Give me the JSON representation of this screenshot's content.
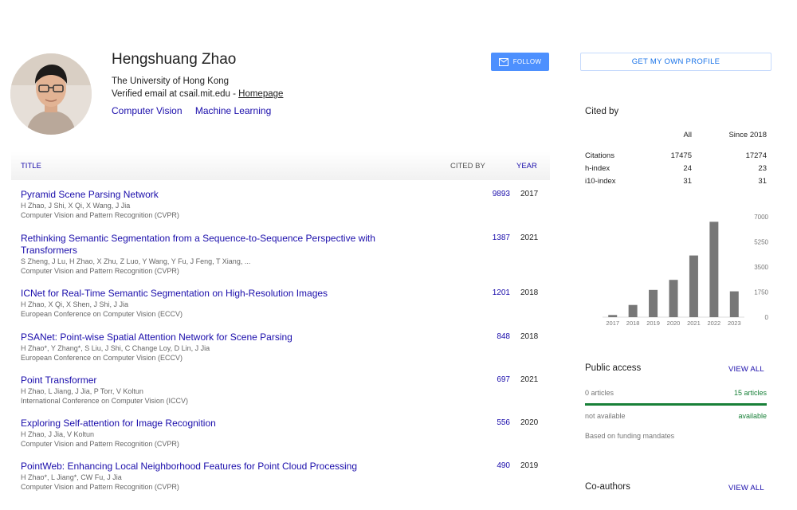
{
  "profile": {
    "name": "Hengshuang Zhao",
    "affiliation": "The University of Hong Kong",
    "email_prefix": "Verified email at csail.mit.edu - ",
    "homepage_label": "Homepage",
    "interests": [
      "Computer Vision",
      "Machine Learning"
    ]
  },
  "buttons": {
    "follow": "FOLLOW",
    "get_profile": "GET MY OWN PROFILE"
  },
  "table": {
    "headers": {
      "title": "TITLE",
      "cited_by": "CITED BY",
      "year": "YEAR"
    },
    "articles": [
      {
        "title": "Pyramid Scene Parsing Network",
        "authors": "H Zhao, J Shi, X Qi, X Wang, J Jia",
        "venue": "Computer Vision and Pattern Recognition (CVPR)",
        "cited": "9893",
        "year": "2017"
      },
      {
        "title": "Rethinking Semantic Segmentation from a Sequence-to-Sequence Perspective with Transformers",
        "authors": "S Zheng, J Lu, H Zhao, X Zhu, Z Luo, Y Wang, Y Fu, J Feng, T Xiang, ...",
        "venue": "Computer Vision and Pattern Recognition (CVPR)",
        "cited": "1387",
        "year": "2021"
      },
      {
        "title": "ICNet for Real-Time Semantic Segmentation on High-Resolution Images",
        "authors": "H Zhao, X Qi, X Shen, J Shi, J Jia",
        "venue": "European Conference on Computer Vision (ECCV)",
        "cited": "1201",
        "year": "2018"
      },
      {
        "title": "PSANet: Point-wise Spatial Attention Network for Scene Parsing",
        "authors": "H Zhao*, Y Zhang*, S Liu, J Shi, C Change Loy, D Lin, J Jia",
        "venue": "European Conference on Computer Vision (ECCV)",
        "cited": "848",
        "year": "2018"
      },
      {
        "title": "Point Transformer",
        "authors": "H Zhao, L Jiang, J Jia, P Torr, V Koltun",
        "venue": "International Conference on Computer Vision (ICCV)",
        "cited": "697",
        "year": "2021"
      },
      {
        "title": "Exploring Self-attention for Image Recognition",
        "authors": "H Zhao, J Jia, V Koltun",
        "venue": "Computer Vision and Pattern Recognition (CVPR)",
        "cited": "556",
        "year": "2020"
      },
      {
        "title": "PointWeb: Enhancing Local Neighborhood Features for Point Cloud Processing",
        "authors": "H Zhao*, L Jiang*, CW Fu, J Jia",
        "venue": "Computer Vision and Pattern Recognition (CVPR)",
        "cited": "490",
        "year": "2019"
      }
    ]
  },
  "cited_by": {
    "title": "Cited by",
    "columns": [
      "All",
      "Since 2018"
    ],
    "rows": [
      {
        "label": "Citations",
        "all": "17475",
        "since": "17274"
      },
      {
        "label": "h-index",
        "all": "24",
        "since": "23"
      },
      {
        "label": "i10-index",
        "all": "31",
        "since": "31"
      }
    ]
  },
  "chart_data": {
    "type": "bar",
    "categories": [
      "2017",
      "2018",
      "2019",
      "2020",
      "2021",
      "2022",
      "2023"
    ],
    "values": [
      150,
      850,
      1900,
      2600,
      4300,
      6650,
      1800
    ],
    "yticks": [
      0,
      1750,
      3500,
      5250,
      7000
    ],
    "ylim": [
      0,
      7000
    ],
    "bar_color": "#777777"
  },
  "public_access": {
    "title": "Public access",
    "view_all": "VIEW ALL",
    "left_top": "0 articles",
    "right_top": "15 articles",
    "left_bottom": "not available",
    "right_bottom": "available",
    "note": "Based on funding mandates"
  },
  "coauthors": {
    "title": "Co-authors",
    "view_all": "VIEW ALL"
  }
}
